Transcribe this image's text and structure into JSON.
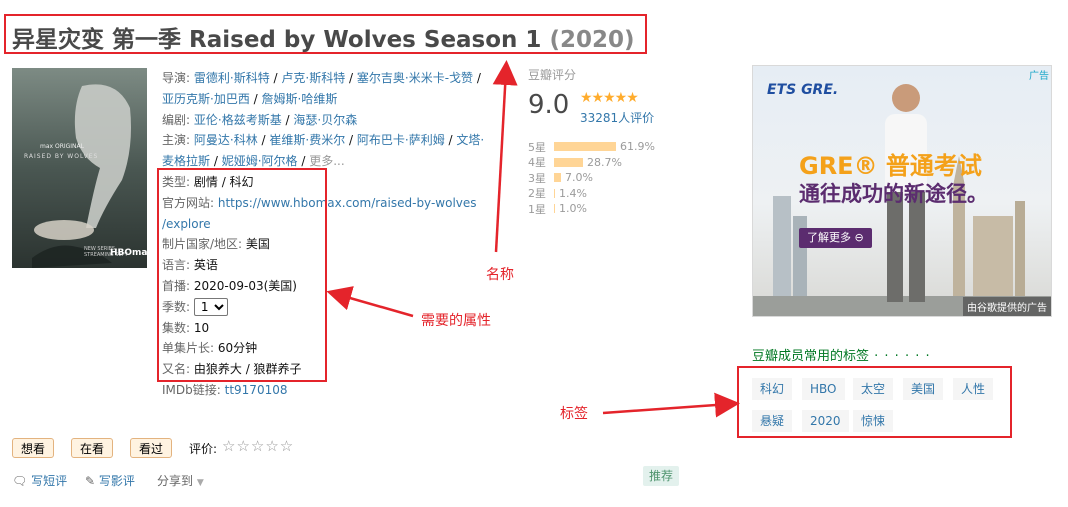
{
  "title": {
    "main": "异星灾变 第一季 Raised by Wolves Season 1",
    "year": "(2020)"
  },
  "poster": {
    "logo": "max ORIGINAL",
    "name": "RAISED BY WOLVES",
    "badge": "HBOmax",
    "note1": "NEW SERIES",
    "note2": "STREAMING SEPT"
  },
  "info": {
    "director_label": "导演:",
    "directors": [
      "雷德利·斯科特",
      "卢克·斯科特",
      "塞尔吉奥·米米卡-戈赞",
      "亚历克斯·加巴西",
      "詹姆斯·哈维斯"
    ],
    "writer_label": "编剧:",
    "writers": [
      "亚伦·格兹考斯基",
      "海瑟·贝尔森"
    ],
    "cast_label": "主演:",
    "cast": [
      "阿曼达·科林",
      "崔维斯·费米尔",
      "阿布巴卡·萨利姆",
      "文塔·麦格拉斯",
      "妮娅姆·阿尔格"
    ],
    "cast_more": "更多...",
    "genre_label": "类型:",
    "genre": "剧情 / 科幻",
    "site_label": "官方网站:",
    "site_line1": "https://www.hbomax.com/raised-by-wolves",
    "site_line2": "/explore",
    "country_label": "制片国家/地区:",
    "country": "美国",
    "lang_label": "语言:",
    "lang": "英语",
    "premiere_label": "首播:",
    "premiere": "2020-09-03(美国)",
    "season_label": "季数:",
    "season": "1",
    "episodes_label": "集数:",
    "episodes": "10",
    "runtime_label": "单集片长:",
    "runtime": "60分钟",
    "aka_label": "又名:",
    "aka": "由狼养大 / 狼群养子",
    "imdb_label": "IMDb链接:",
    "imdb": "tt9170108"
  },
  "rating": {
    "label": "豆瓣评分",
    "score": "9.0",
    "stars": "★★★★★",
    "count": "33281人评价",
    "rows": [
      {
        "star": "5星",
        "pct": "61.9%",
        "fill": 0.619
      },
      {
        "star": "4星",
        "pct": "28.7%",
        "fill": 0.287
      },
      {
        "star": "3星",
        "pct": "7.0%",
        "fill": 0.07
      },
      {
        "star": "2星",
        "pct": "1.4%",
        "fill": 0.014
      },
      {
        "star": "1星",
        "pct": "1.0%",
        "fill": 0.01
      }
    ]
  },
  "ad": {
    "brand": "ETS GRE.",
    "tag": "广告",
    "headline": "GRE® 普通考试",
    "headline2": "通往成功的新途径。",
    "learn": "了解更多 ⊖",
    "footer": "由谷歌提供的广告"
  },
  "tags": {
    "title": "豆瓣成员常用的标签",
    "dots": " · · · · · ·",
    "items": [
      "科幻",
      "HBO",
      "太空",
      "美国",
      "人性",
      "悬疑",
      "2020",
      "惊悚"
    ]
  },
  "annotations": {
    "name": "名称",
    "attrs": "需要的属性",
    "tags": "标签"
  },
  "actions": {
    "want": "想看",
    "watching": "在看",
    "watched": "看过",
    "rate_label": "评价:",
    "rate_stars": "☆☆☆☆☆",
    "short_review": "写短评",
    "long_review": "写影评",
    "share": "分享到",
    "recommend": "推荐"
  },
  "colors": {
    "annotation": "#e4242b",
    "link": "#3377aa",
    "tag_title": "#007722",
    "star": "#ffac2d"
  }
}
